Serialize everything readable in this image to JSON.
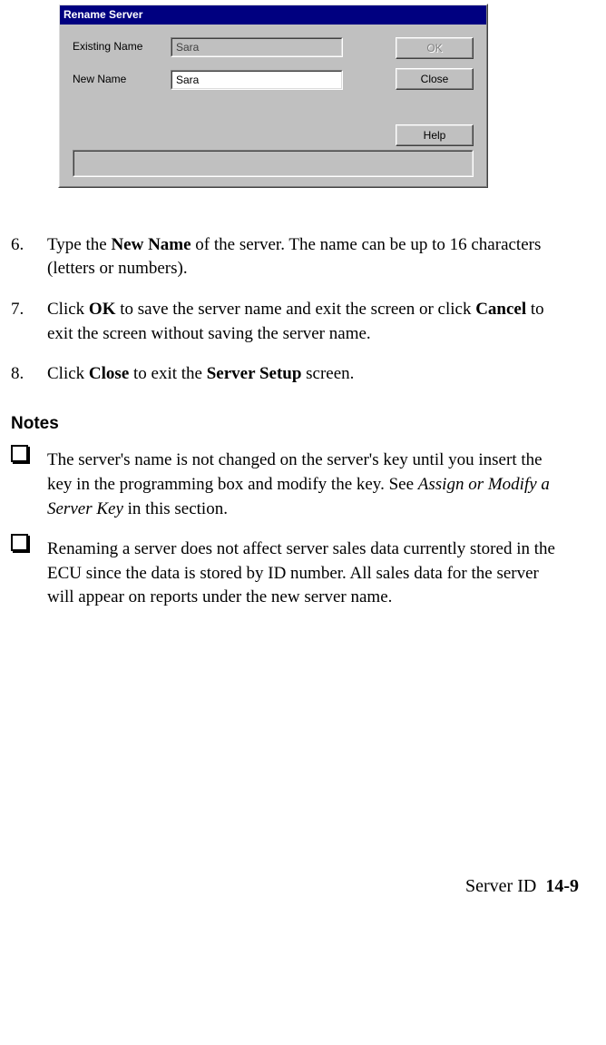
{
  "dialog": {
    "title": "Rename Server",
    "existing_label": "Existing Name",
    "existing_value": "Sara",
    "new_label": "New Name",
    "new_value": "Sara",
    "ok_label": "OK",
    "close_label": "Close",
    "help_label": "Help"
  },
  "steps": [
    {
      "num": "6.",
      "pre": "Type the ",
      "bold1": "New Name",
      "post": " of the server. The name can be up to 16 characters (letters or numbers)."
    },
    {
      "num": "7.",
      "pre": "Click ",
      "bold1": "OK",
      "mid1": " to save the server name and exit the screen or click ",
      "bold2": "Cancel",
      "post": " to exit the screen without saving the server name."
    },
    {
      "num": "8.",
      "pre": "Click ",
      "bold1": "Close",
      "mid1": " to exit the ",
      "bold2": "Server Setup",
      "post": " screen."
    }
  ],
  "notes_heading": "Notes",
  "notes": [
    {
      "pre": "The server's name is not changed on the server's key until you insert the key in the programming box and modify the key. See ",
      "italic": "Assign or Modify a Server Key",
      "post": " in this section."
    },
    {
      "pre": "Renaming a server does not affect server sales data currently stored in the ECU since the data is stored by ID number. All sales data for the server will appear on reports under the new server name.",
      "italic": "",
      "post": ""
    }
  ],
  "footer": {
    "label": "Server ID",
    "page": "14-9"
  }
}
